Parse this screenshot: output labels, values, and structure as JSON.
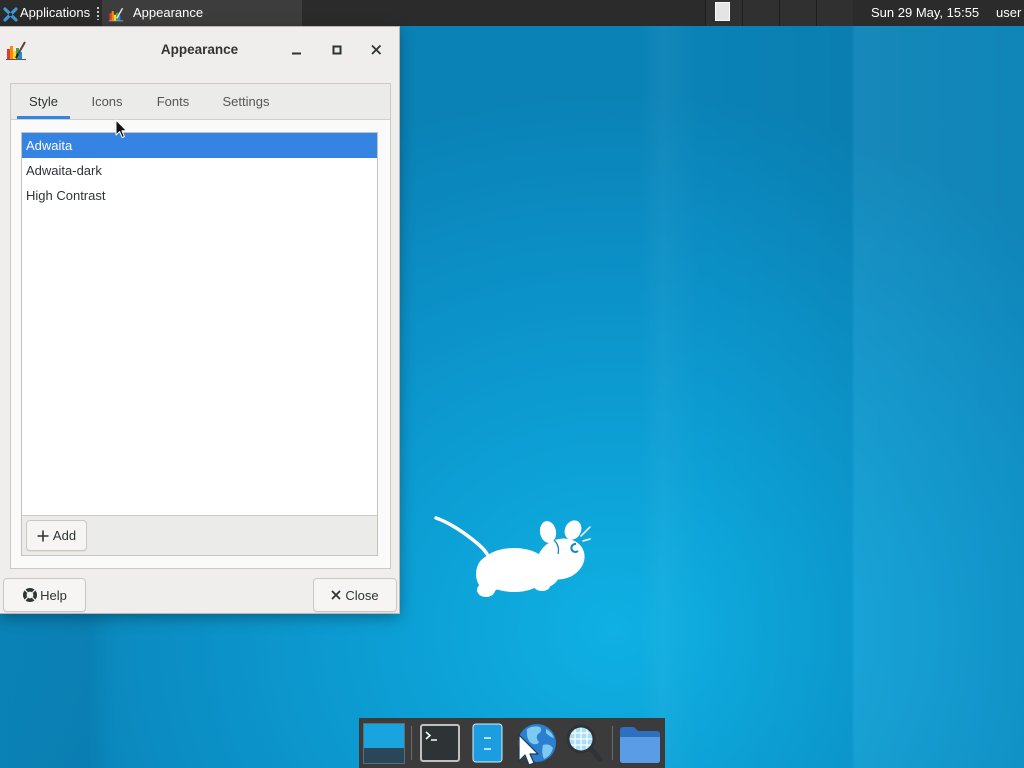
{
  "panel": {
    "applications_label": "Applications",
    "task_title": "Appearance",
    "clock": "Sun 29 May, 15:55",
    "user": "user"
  },
  "window": {
    "title": "Appearance",
    "tabs": [
      {
        "label": "Style",
        "selected": true
      },
      {
        "label": "Icons",
        "selected": false
      },
      {
        "label": "Fonts",
        "selected": false
      },
      {
        "label": "Settings",
        "selected": false
      }
    ],
    "themes": [
      {
        "label": "Adwaita",
        "selected": true
      },
      {
        "label": "Adwaita-dark",
        "selected": false
      },
      {
        "label": "High Contrast",
        "selected": false
      }
    ],
    "add_label": "Add",
    "help_label": "Help",
    "close_label": "Close"
  },
  "icons": {
    "panel": [
      "xfce-logo-icon",
      "appearance-icon"
    ],
    "titlebar": [
      "appearance-icon",
      "minimize-icon",
      "maximize-icon",
      "close-icon"
    ],
    "buttons": {
      "add": "plus-icon",
      "help": "help-icon",
      "close": "close-icon"
    },
    "desktop_logo": "xfce-mouse-logo",
    "pointer": "mouse-pointer-icon"
  },
  "dock": {
    "items": [
      "show-desktop-icon",
      "terminal-icon",
      "text-editor-icon",
      "web-browser-icon",
      "search-icon",
      "folder-icon"
    ]
  },
  "colors": {
    "selection": "#3584e4",
    "panel": "#2b2b2b",
    "dock": "#3b3b3b",
    "window": "#efeeec",
    "desktop": "#0b8dc3"
  }
}
